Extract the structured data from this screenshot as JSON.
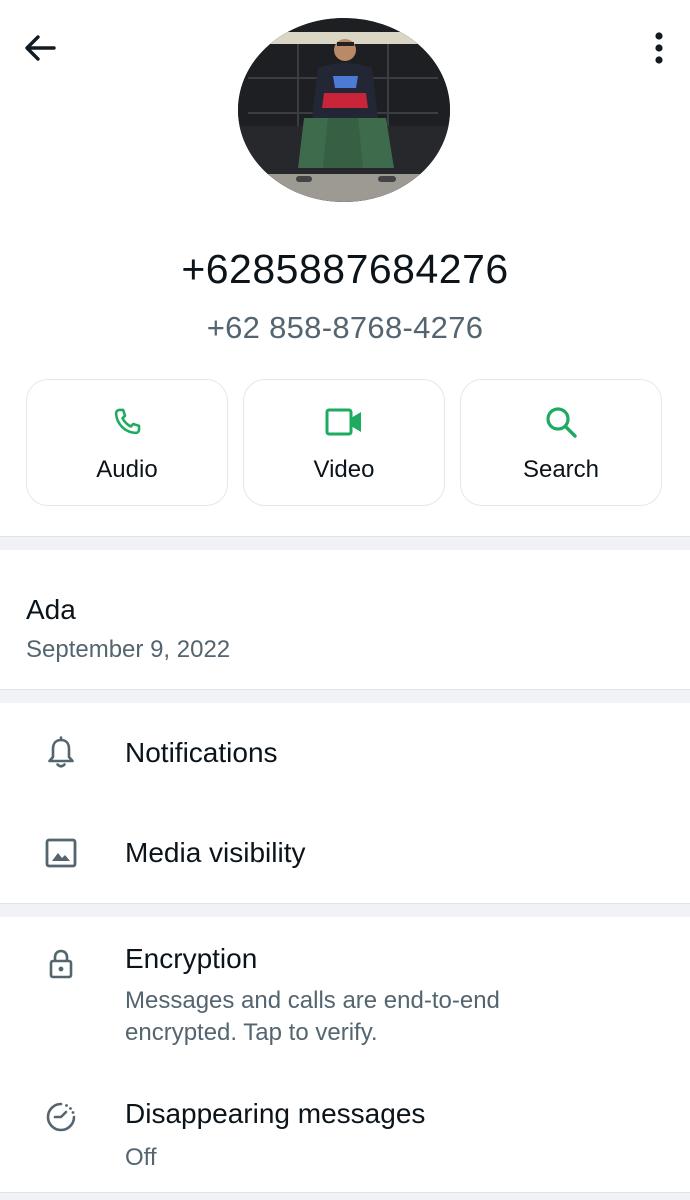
{
  "header": {
    "back_icon": "arrow-left-icon",
    "menu_icon": "more-vert-icon"
  },
  "profile": {
    "name": "+6285887684276",
    "phone": "+62 858-8768-4276"
  },
  "actions": [
    {
      "label": "Audio",
      "icon": "phone-icon"
    },
    {
      "label": "Video",
      "icon": "videocam-icon"
    },
    {
      "label": "Search",
      "icon": "search-icon"
    }
  ],
  "about": {
    "status": "Ada",
    "date": "September 9, 2022"
  },
  "settings": {
    "notifications": "Notifications",
    "media_visibility": "Media visibility",
    "encryption": {
      "title": "Encryption",
      "subtitle_line1": "Messages and calls are end-to-end",
      "subtitle_line2": "encrypted. Tap to verify."
    },
    "disappearing": {
      "title": "Disappearing messages",
      "value": "Off"
    }
  },
  "colors": {
    "accent": "#1daa61",
    "text_primary": "#0b141a",
    "text_secondary": "#54656f",
    "divider": "#f0f2f5"
  }
}
